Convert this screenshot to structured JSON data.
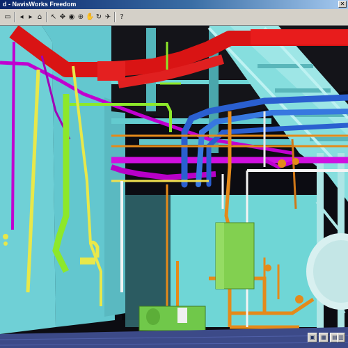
{
  "window": {
    "title": "d - NavisWorks Freedom"
  },
  "toolbar": {
    "buttons": [
      {
        "name": "open-icon",
        "glyph": "▭"
      },
      {
        "name": "back-icon",
        "glyph": "◂"
      },
      {
        "name": "forward-icon",
        "glyph": "▸"
      },
      {
        "name": "home-icon",
        "glyph": "⌂"
      },
      {
        "name": "select-icon",
        "glyph": "↖"
      },
      {
        "name": "walk-icon",
        "glyph": "✥"
      },
      {
        "name": "look-icon",
        "glyph": "◉"
      },
      {
        "name": "zoom-icon",
        "glyph": "⊕"
      },
      {
        "name": "pan-icon",
        "glyph": "✋"
      },
      {
        "name": "orbit-icon",
        "glyph": "↻"
      },
      {
        "name": "fly-icon",
        "glyph": "✈"
      },
      {
        "name": "help-icon",
        "glyph": "?"
      }
    ]
  },
  "statusbar": {
    "buttons": [
      {
        "name": "status-view-icon",
        "glyph": "▣"
      },
      {
        "name": "status-grid-icon",
        "glyph": "▦"
      },
      {
        "name": "status-layers-icon",
        "glyph": "▤"
      },
      {
        "name": "status-info-icon",
        "glyph": "▥"
      }
    ]
  },
  "colors": {
    "title_gradient_start": "#0a246a",
    "title_gradient_end": "#a6caf0",
    "duct_red": "#e01818",
    "pipe_blue": "#2a6fd6",
    "pipe_magenta": "#c000d0",
    "pipe_orange": "#e48a1a",
    "pipe_yellow": "#e8e84a",
    "pipe_green": "#8de82a",
    "structure_cyan": "#6fd8d8",
    "equipment_green": "#7fcf4a"
  }
}
